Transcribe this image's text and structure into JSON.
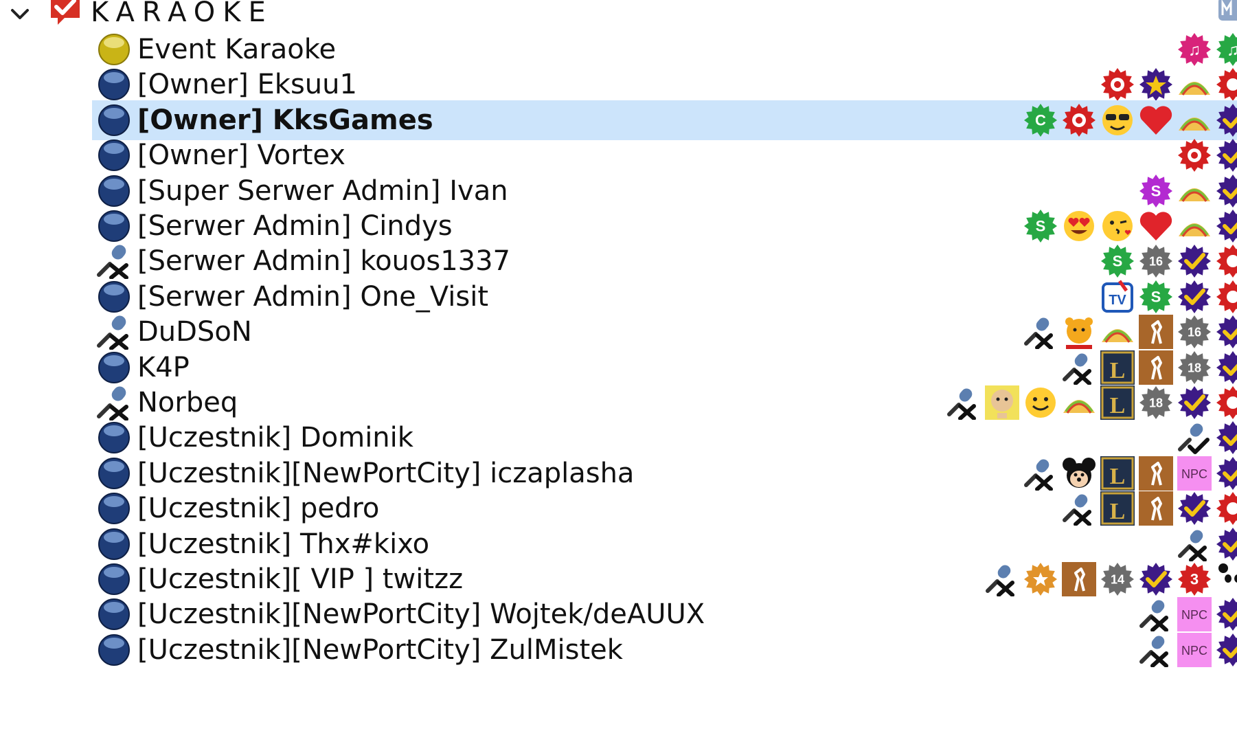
{
  "channel": {
    "title": "KARAOKE"
  },
  "clients": [
    {
      "name": "Event Karaoke",
      "status": "gold-status-icon",
      "selected": false,
      "icons": [
        "music-badge-icon",
        "music-badge-green-icon"
      ]
    },
    {
      "name": "[Owner] Eksuu1",
      "status": "talk-status-icon",
      "selected": false,
      "icons": [
        "owner-gear-icon",
        "star-gear-icon",
        "taco-icon",
        "group-gear-icon"
      ]
    },
    {
      "name": "[Owner] KksGames",
      "status": "talk-status-icon",
      "selected": true,
      "icons": [
        "green-c-gear-icon",
        "owner-gear-icon",
        "sunglasses-emoji-icon",
        "heart-icon",
        "taco-icon",
        "check-gear-icon"
      ]
    },
    {
      "name": "[Owner] Vortex",
      "status": "talk-status-icon",
      "selected": false,
      "icons": [
        "owner-gear-icon",
        "check-gear-icon"
      ]
    },
    {
      "name": "[Super Serwer Admin] Ivan",
      "status": "talk-status-icon",
      "selected": false,
      "icons": [
        "super-admin-gear-icon",
        "taco-icon",
        "check-gear-icon"
      ]
    },
    {
      "name": "[Serwer Admin] Cindys",
      "status": "talk-status-icon",
      "selected": false,
      "icons": [
        "admin-gear-icon",
        "heart-eyes-emoji-icon",
        "kiss-emoji-icon",
        "heart-icon",
        "taco-icon",
        "check-gear-icon"
      ]
    },
    {
      "name": "[Serwer Admin] kouos1337",
      "status": "muted-mic-icon",
      "selected": false,
      "icons": [
        "admin-gear-icon",
        "age-16-gear-icon",
        "check-gear-icon",
        "group-gear-icon"
      ]
    },
    {
      "name": "[Serwer Admin] One_Visit",
      "status": "talk-status-icon",
      "selected": false,
      "icons": [
        "tv-logo-icon",
        "admin-gear-icon",
        "check-gear-icon",
        "group-gear-icon"
      ]
    },
    {
      "name": "DuDSoN",
      "status": "muted-mic-icon",
      "selected": false,
      "icons": [
        "muted-mic-icon",
        "pooh-avatar-icon",
        "taco-icon",
        "csgo-rank-icon",
        "age-16-gear-icon",
        "check-gear-icon"
      ]
    },
    {
      "name": "K4P",
      "status": "talk-status-icon",
      "selected": false,
      "icons": [
        "muted-mic-icon",
        "lol-badge-icon",
        "csgo-rank-icon",
        "age-18-gear-icon",
        "check-gear-icon"
      ]
    },
    {
      "name": "Norbeq",
      "status": "muted-mic-icon",
      "selected": false,
      "icons": [
        "muted-mic-icon",
        "doge-avatar-icon",
        "smile-emoji-icon",
        "taco-icon",
        "lol-badge-icon",
        "age-18-gear-icon",
        "check-gear-icon",
        "group-gear-icon"
      ]
    },
    {
      "name": "[Uczestnik] Dominik",
      "status": "talk-status-icon",
      "selected": false,
      "icons": [
        "mic-check-icon",
        "check-gear-icon"
      ]
    },
    {
      "name": "[Uczestnik][NewPortCity] iczaplasha",
      "status": "talk-status-icon",
      "selected": false,
      "icons": [
        "muted-mic-icon",
        "mickey-avatar-icon",
        "lol-badge-icon",
        "csgo-rank-icon",
        "npc-badge-icon",
        "check-gear-icon"
      ]
    },
    {
      "name": "[Uczestnik] pedro",
      "status": "talk-status-icon",
      "selected": false,
      "icons": [
        "muted-mic-icon",
        "lol-badge-icon",
        "csgo-rank-icon",
        "check-gear-icon",
        "group-gear-icon"
      ]
    },
    {
      "name": "[Uczestnik] Thx#kixo",
      "status": "talk-status-icon",
      "selected": false,
      "icons": [
        "muted-mic-icon",
        "check-gear-icon"
      ]
    },
    {
      "name": "[Uczestnik][ VIP ] twitzz",
      "status": "talk-status-icon",
      "selected": false,
      "icons": [
        "muted-mic-icon",
        "vip-gear-icon",
        "csgo-rank-icon",
        "age-14-gear-icon",
        "check-gear-icon",
        "rank-3-gear-icon",
        "panda-icon"
      ]
    },
    {
      "name": "[Uczestnik][NewPortCity] Wojtek/deAUUX",
      "status": "talk-status-icon",
      "selected": false,
      "icons": [
        "muted-mic-icon",
        "npc-badge-icon",
        "check-gear-icon"
      ]
    },
    {
      "name": "[Uczestnik][NewPortCity] ZulMistek",
      "status": "talk-status-icon",
      "selected": false,
      "icons": [
        "muted-mic-icon",
        "npc-badge-icon",
        "check-gear-icon"
      ]
    }
  ],
  "badge_text": {
    "owner": "O",
    "super_admin": "S",
    "admin": "S",
    "green_c": "C",
    "age_14": "14",
    "age_16": "16",
    "age_18": "18",
    "lol": "L",
    "npc": "NPC",
    "rank_3": "3",
    "music": "♫",
    "tv": "TV"
  },
  "colors": {
    "selection": "#cce4fb",
    "owner_gear": "#d32020",
    "admin_gear": "#27a844",
    "super_admin_gear": "#b32ad1",
    "check_gear": "#3d1a86",
    "music_gear": "#d8237a",
    "age_gear": "#6c6c6c",
    "vip_gear": "#e1932a",
    "csgo_rank": "#a8662a",
    "lol_badge": "#20304a",
    "npc_badge": "#f58ff0",
    "talk_status": "#1f3d78",
    "gold_status": "#c9b416"
  }
}
